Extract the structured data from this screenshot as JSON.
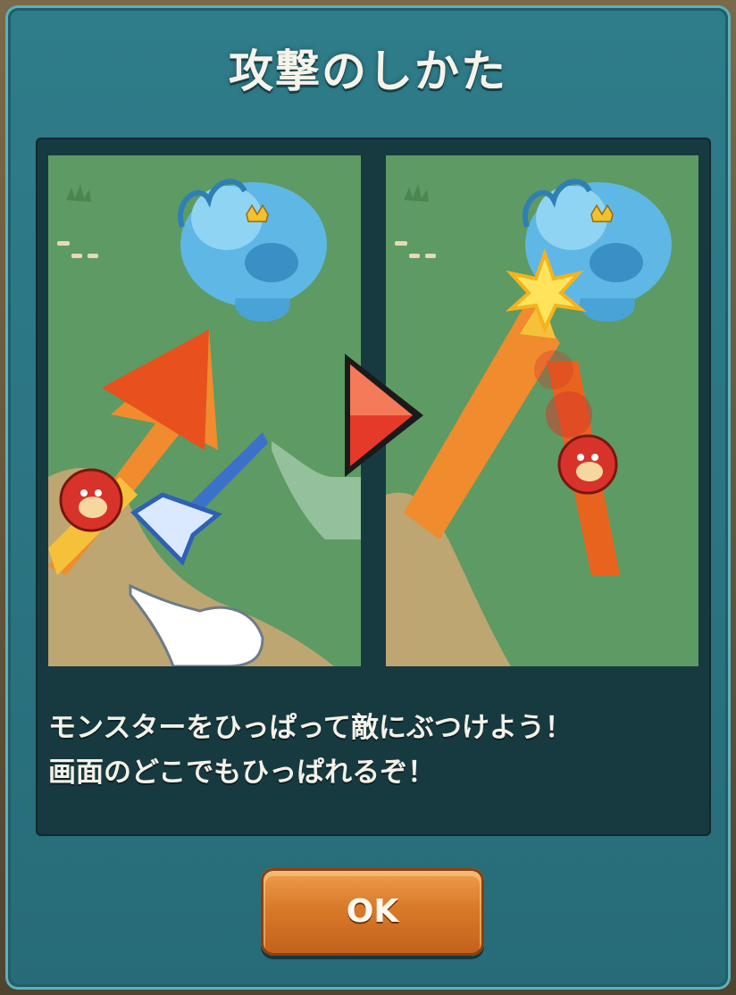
{
  "dialog": {
    "title": "攻撃のしかた",
    "description_lines": [
      "モンスターをひっぱって敵にぶつけよう！",
      "画面のどこでもひっぱれるぞ！"
    ],
    "ok_label": "OK"
  },
  "illustrations": {
    "left_scene": [
      "water-monster-icon",
      "orange-arrow-icon",
      "dragon-monster-icon",
      "blue-pull-arrow-icon",
      "pointing-hand-icon",
      "ghost-hand-icon"
    ],
    "right_scene": [
      "water-monster-icon",
      "impact-burst-icon",
      "trajectory-beam-icon",
      "dragon-monster-icon"
    ],
    "transition": "red-play-arrow-icon"
  },
  "colors": {
    "dialog_teal": "#2b7582",
    "panel_dark": "#173a40",
    "grass": "#5f9a64",
    "button_orange": "#d97a2a"
  }
}
